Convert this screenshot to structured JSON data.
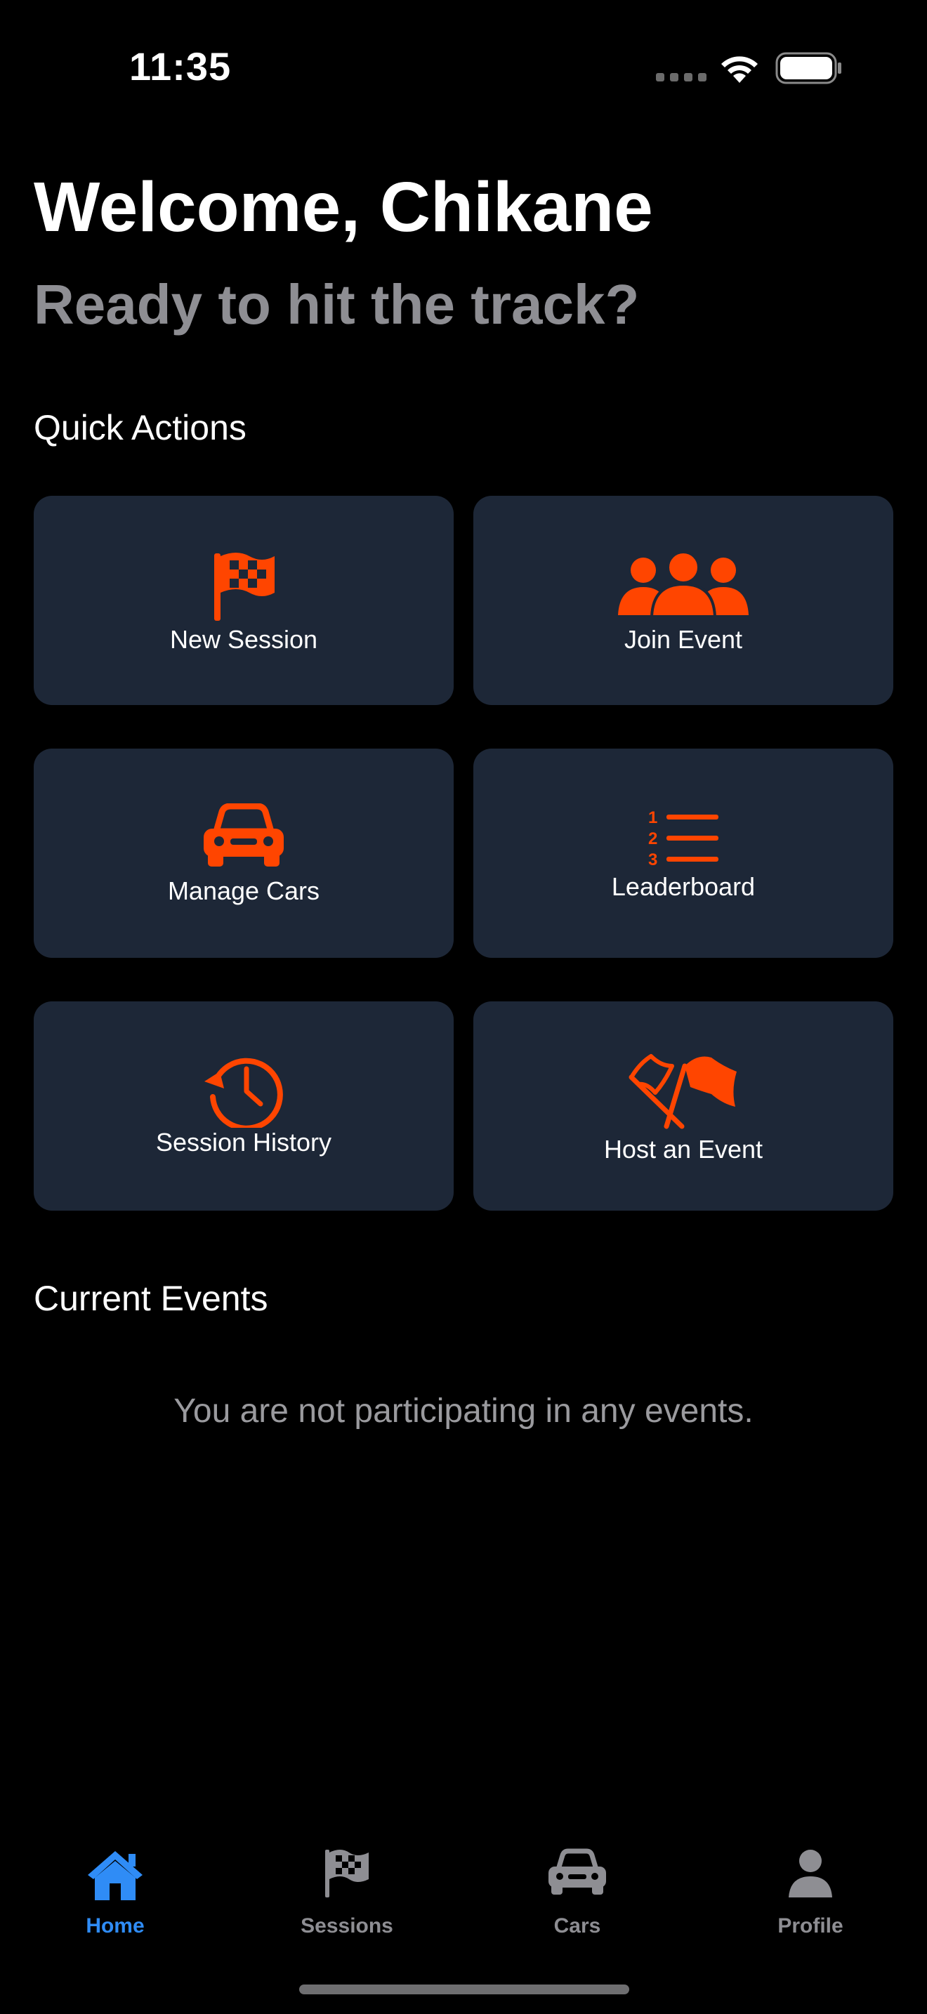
{
  "status_bar": {
    "time": "11:35",
    "icons": [
      "cellular-dots-icon",
      "wifi-icon",
      "battery-icon"
    ]
  },
  "header": {
    "greeting": "Welcome, Chikane",
    "subtitle": "Ready to hit the track?"
  },
  "quick_actions": {
    "title": "Quick Actions",
    "items": [
      {
        "label": "New Session",
        "icon": "checkered-flag-icon"
      },
      {
        "label": "Join Event",
        "icon": "group-icon"
      },
      {
        "label": "Manage Cars",
        "icon": "car-icon"
      },
      {
        "label": "Leaderboard",
        "icon": "numbered-list-icon"
      },
      {
        "label": "Session History",
        "icon": "history-clock-icon"
      },
      {
        "label": "Host an Event",
        "icon": "crossed-flags-icon"
      }
    ]
  },
  "current_events": {
    "title": "Current Events",
    "empty_message": "You are not participating in any events."
  },
  "tab_bar": {
    "tabs": [
      {
        "label": "Home",
        "icon": "house-icon",
        "active": true
      },
      {
        "label": "Sessions",
        "icon": "checkered-flag-icon",
        "active": false
      },
      {
        "label": "Cars",
        "icon": "car-icon",
        "active": false
      },
      {
        "label": "Profile",
        "icon": "person-icon",
        "active": false
      }
    ]
  },
  "colors": {
    "background": "#000000",
    "card": "#1d2737",
    "accent": "#ff4500",
    "tab_active": "#2f8cf6",
    "tab_inactive": "#8e8e93",
    "subtitle": "#8e8e93"
  }
}
